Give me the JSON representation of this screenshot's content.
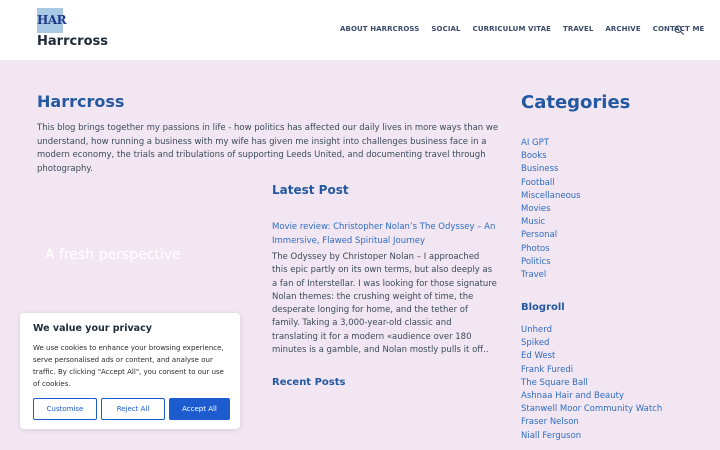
{
  "header": {
    "logo_text": "HAR",
    "site_title": "Harrcross",
    "nav": [
      "ABOUT HARRCROSS",
      "SOCIAL",
      "CURRICULUM VITAE",
      "TRAVEL",
      "ARCHIVE",
      "CONTACT ME"
    ]
  },
  "main": {
    "title": "Harrcross",
    "intro": "This blog brings together my passions in life - how politics has affected our daily lives in more ways than we understand, how running a business with my wife has given me insight into challenges business face in a modern economy, the trials and tribulations of supporting Leeds United, and documenting travel through photography.",
    "hero_text": "A fresh perspective",
    "latest_title": "Latest Post",
    "post_title": "Movie review: Christopher Nolan’s The Odyssey – An Immersive, Flawed Spiritual Journey",
    "post_excerpt": "The Odyssey by Christoper Nolan – I approached this epic partly on its own terms, but also deeply as a fan of Interstellar.  I was looking for those signature Nolan themes: the crushing weight of time, the desperate longing for home, and the tether of family. Taking a 3,000-year-old classic and translating it for a modern «audience over 180 minutes is a gamble, and Nolan mostly pulls it off..",
    "recent_title": "Recent Posts"
  },
  "sidebar": {
    "categories_title": "Categories",
    "categories": [
      "AI GPT",
      "Books",
      "Business",
      "Football",
      "Miscellaneous",
      "Movies",
      "Music",
      "Personal",
      "Photos",
      "Politics",
      "Travel"
    ],
    "blogroll_title": "Blogroll",
    "blogroll": [
      "Unherd",
      "Spiked",
      "Ed West",
      "Frank Furedi",
      "The Square Ball",
      "Ashnaa Hair and Beauty",
      "Stanwell Moor Community Watch",
      "Fraser Nelson",
      "Niall Ferguson"
    ]
  },
  "cookie": {
    "title": "We value your privacy",
    "text": "We use cookies to enhance your browsing experience, serve personalised ads or content, and analyse our traffic. By clicking \"Accept All\", you consent to our use of cookies.",
    "customise": "Customise",
    "reject": "Reject All",
    "accept": "Accept All"
  },
  "colors": {
    "background": "#f2e6f2",
    "accent": "#2458a0",
    "link": "#2f6cc0",
    "button": "#1c5ccf"
  }
}
